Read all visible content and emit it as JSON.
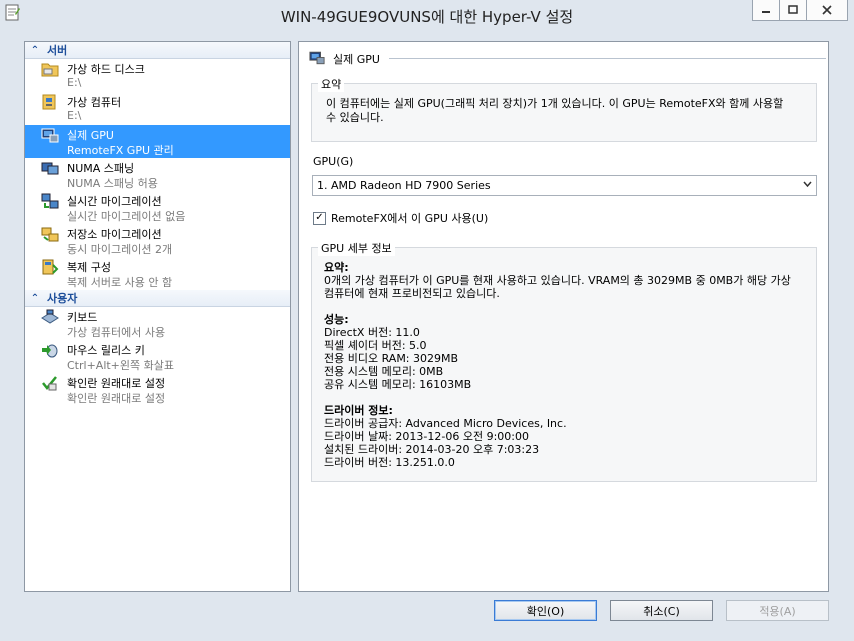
{
  "window": {
    "title": "WIN-49GUE9OVUNS에 대한 Hyper-V 설정"
  },
  "sidebar": {
    "sections": [
      {
        "label": "서버",
        "items": [
          {
            "title": "가상 하드 디스크",
            "subtitle": "E:\\",
            "icon": "folder-icon"
          },
          {
            "title": "가상 컴퓨터",
            "subtitle": "E:\\",
            "icon": "vm-folder-icon"
          },
          {
            "title": "실제 GPU",
            "subtitle": "RemoteFX GPU 관리",
            "icon": "gpu-icon",
            "selected": true
          },
          {
            "title": "NUMA 스패닝",
            "subtitle": "NUMA 스패닝 허용",
            "icon": "numa-icon"
          },
          {
            "title": "실시간 마이그레이션",
            "subtitle": "실시간 마이그레이션 없음",
            "icon": "live-migration-icon"
          },
          {
            "title": "저장소 마이그레이션",
            "subtitle": "동시 마이그레이션 2개",
            "icon": "storage-migration-icon"
          },
          {
            "title": "복제 구성",
            "subtitle": "복제 서버로 사용 안 함",
            "icon": "replication-icon"
          }
        ]
      },
      {
        "label": "사용자",
        "items": [
          {
            "title": "키보드",
            "subtitle": "가상 컴퓨터에서 사용",
            "icon": "keyboard-icon"
          },
          {
            "title": "마우스 릴리스 키",
            "subtitle": "Ctrl+Alt+왼쪽 화살표",
            "icon": "mouse-release-icon"
          },
          {
            "title": "확인란 원래대로 설정",
            "subtitle": "확인란 원래대로 설정",
            "icon": "reset-checkbox-icon"
          }
        ]
      }
    ]
  },
  "main": {
    "header": "실제 GPU",
    "summary": {
      "label": "요약",
      "text_line1": "이 컴퓨터에는 실제 GPU(그래픽 처리 장치)가 1개 있습니다. 이 GPU는 RemoteFX와 함께 사용할",
      "text_line2": "수 있습니다."
    },
    "gpu_label": "GPU(G)",
    "gpu_selected": "1. AMD Radeon HD 7900 Series",
    "remotefx_checkbox": {
      "label": "RemoteFX에서 이 GPU 사용(U)",
      "checked": true
    },
    "details": {
      "label": "GPU 세부 정보",
      "summary_heading": "요약:",
      "summary_line1": "0개의 가상 컴퓨터가 이 GPU를 현재 사용하고 있습니다. VRAM의 총 3029MB 중 0MB가 해당 가상",
      "summary_line2": "컴퓨터에 현재 프로비전되고 있습니다.",
      "perf_heading": "성능:",
      "perf": [
        "DirectX 버전: 11.0",
        "픽셀 셰이더 버전: 5.0",
        "전용 비디오 RAM: 3029MB",
        "전용 시스템 메모리: 0MB",
        "공유 시스템 메모리: 16103MB"
      ],
      "driver_heading": "드라이버 정보:",
      "driver": [
        "드라이버 공급자: Advanced Micro Devices, Inc.",
        "드라이버 날짜: 2013-12-06 오전 9:00:00",
        "설치된 드라이버: 2014-03-20 오후 7:03:23",
        "드라이버 버전: 13.251.0.0"
      ]
    }
  },
  "buttons": {
    "ok": "확인(O)",
    "cancel": "취소(C)",
    "apply": "적용(A)"
  }
}
